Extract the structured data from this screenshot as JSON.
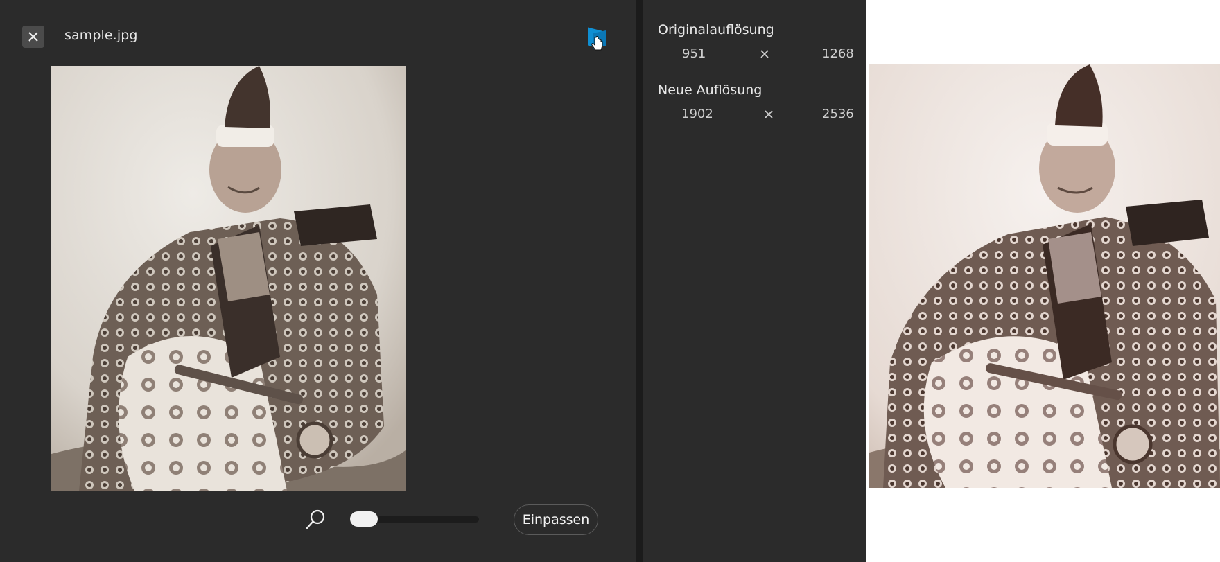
{
  "header": {
    "close_icon": "close-icon",
    "file_name": "sample.jpg",
    "compare_icon": "compare-icon"
  },
  "original_image": {
    "description_icon": "photo-thumbnail"
  },
  "zoom": {
    "icon": "search-icon",
    "level_fraction": 0.0
  },
  "fit_button": {
    "label": "Einpassen"
  },
  "resolution": {
    "original_title": "Originalauflösung",
    "original_width": "951",
    "original_height": "1268",
    "new_title": "Neue Auflösung",
    "new_width": "1902",
    "new_height": "2536",
    "times_icon": "multiply-icon"
  },
  "colors": {
    "panel_bg": "#2b2b2b",
    "accent": "#0f8fd3",
    "text": "#e6e6e6"
  }
}
